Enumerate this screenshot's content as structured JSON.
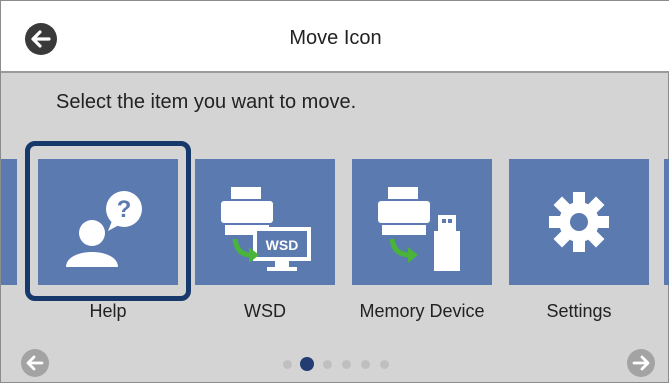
{
  "header": {
    "title": "Move Icon",
    "back_icon": "arrow-left-icon"
  },
  "prompt": "Select the item you want to move.",
  "tiles": [
    {
      "label": "Help",
      "icon": "help-person-icon",
      "selected": true
    },
    {
      "label": "WSD",
      "icon": "scanner-to-computer-icon",
      "selected": false
    },
    {
      "label": "Memory Device",
      "icon": "scanner-to-usb-icon",
      "selected": false
    },
    {
      "label": "Settings",
      "icon": "gear-icon",
      "selected": false
    }
  ],
  "pagination": {
    "total": 6,
    "current": 2
  },
  "nav": {
    "prev_icon": "arrow-left-icon",
    "next_icon": "arrow-right-icon"
  },
  "colors": {
    "tile": "#5b7ab0",
    "selection": "#17386b",
    "active_dot": "#233d73",
    "background": "#d4d4d4"
  }
}
